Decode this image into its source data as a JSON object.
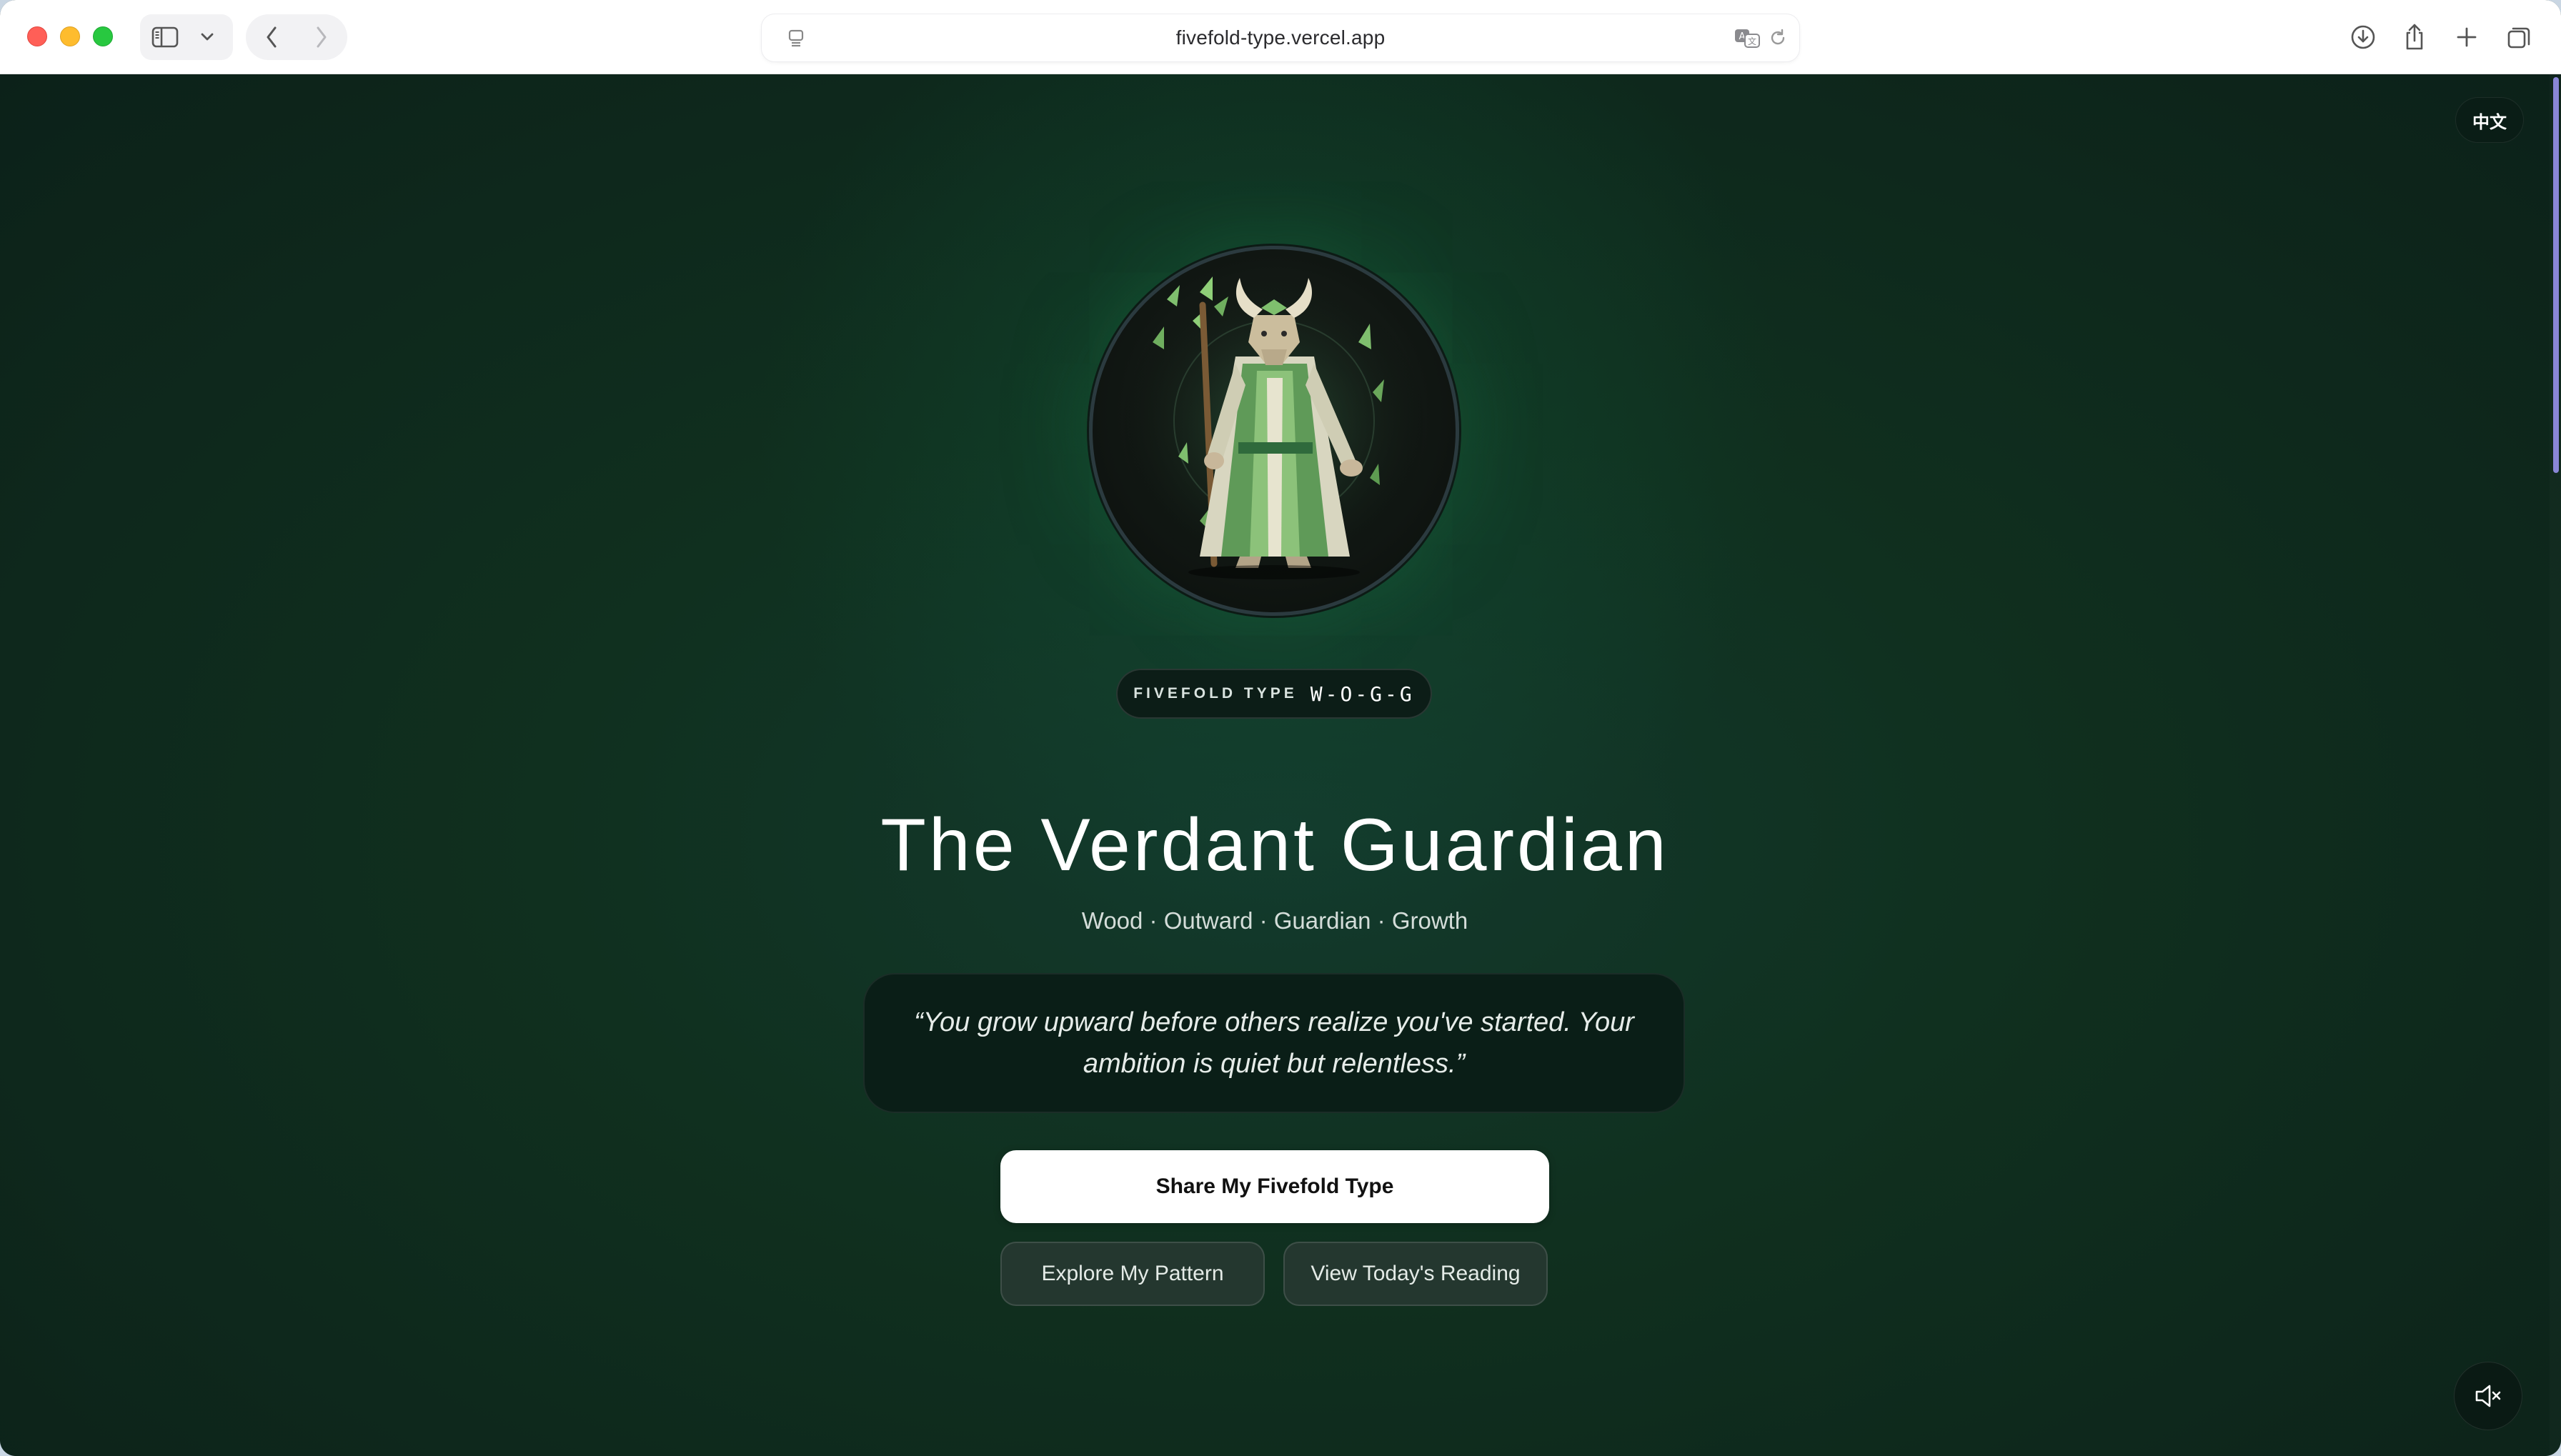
{
  "browser": {
    "url": "fivefold-type.vercel.app",
    "icons": [
      "sidebar-icon",
      "chevron-down-icon",
      "back-icon",
      "forward-icon",
      "page-menu-icon",
      "translate-icon",
      "reload-icon",
      "download-icon",
      "share-icon",
      "new-tab-icon",
      "tabs-overview-icon"
    ]
  },
  "page": {
    "language_toggle": "中文",
    "type_label": "FIVEFOLD TYPE",
    "type_code": "W-O-G-G",
    "title": "The Verdant Guardian",
    "subtitle": "Wood · Outward · Guardian · Growth",
    "quote": "“You grow upward before others realize you've started. Your ambition is quiet but relentless.”",
    "share_button": "Share My Fivefold Type",
    "explore_button": "Explore My Pattern",
    "reading_button": "View Today's Reading",
    "mute_icon": "speaker-muted-icon"
  },
  "colors": {
    "background": "#0f2a20",
    "glow": "#166e42",
    "accent_scroll": "#8a86d6"
  }
}
